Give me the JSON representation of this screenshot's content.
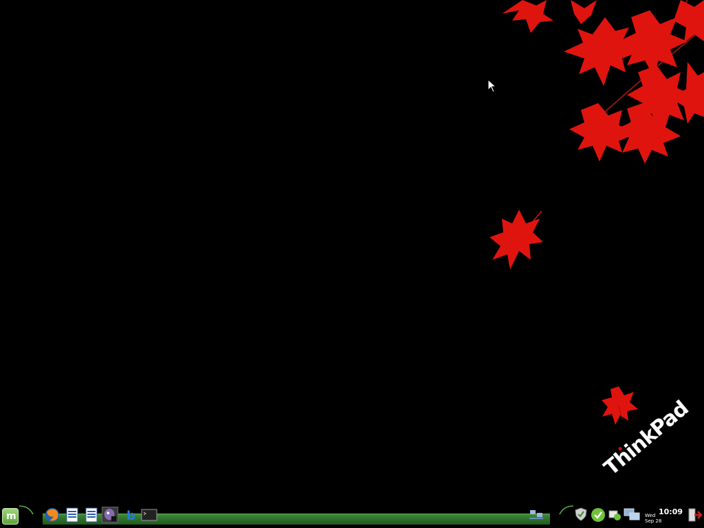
{
  "wallpaper": {
    "brand_text": "ThinkPad",
    "background_color": "#000000",
    "leaf_color": "#e0140f",
    "accent_color": "#e4001b"
  },
  "panel": {
    "bar_color": "#2f7a2c",
    "menu_button": {
      "icon": "mint-logo-icon",
      "glyph": "m"
    },
    "launchers": [
      {
        "name": "firefox-launcher",
        "icon": "firefox-icon"
      },
      {
        "name": "writer-launcher",
        "icon": "document-icon"
      },
      {
        "name": "writer-launcher-2",
        "icon": "document-icon"
      },
      {
        "name": "pidgin-launcher",
        "icon": "chat-icon",
        "active": true
      },
      {
        "name": "app-launcher",
        "icon": "b-app-icon"
      },
      {
        "name": "terminal-launcher",
        "icon": "terminal-icon"
      }
    ],
    "tray": [
      {
        "name": "network-manager",
        "icon": "network-icon"
      },
      {
        "name": "security",
        "icon": "shield-icon"
      },
      {
        "name": "update-manager",
        "icon": "checkmark-icon"
      },
      {
        "name": "notifications",
        "icon": "message-icon"
      },
      {
        "name": "workspace-switcher",
        "icon": "display-icon"
      },
      {
        "name": "logout",
        "icon": "exit-icon"
      }
    ]
  },
  "clock": {
    "time": "10:09",
    "day": "Wed",
    "date": "Sep 28"
  }
}
